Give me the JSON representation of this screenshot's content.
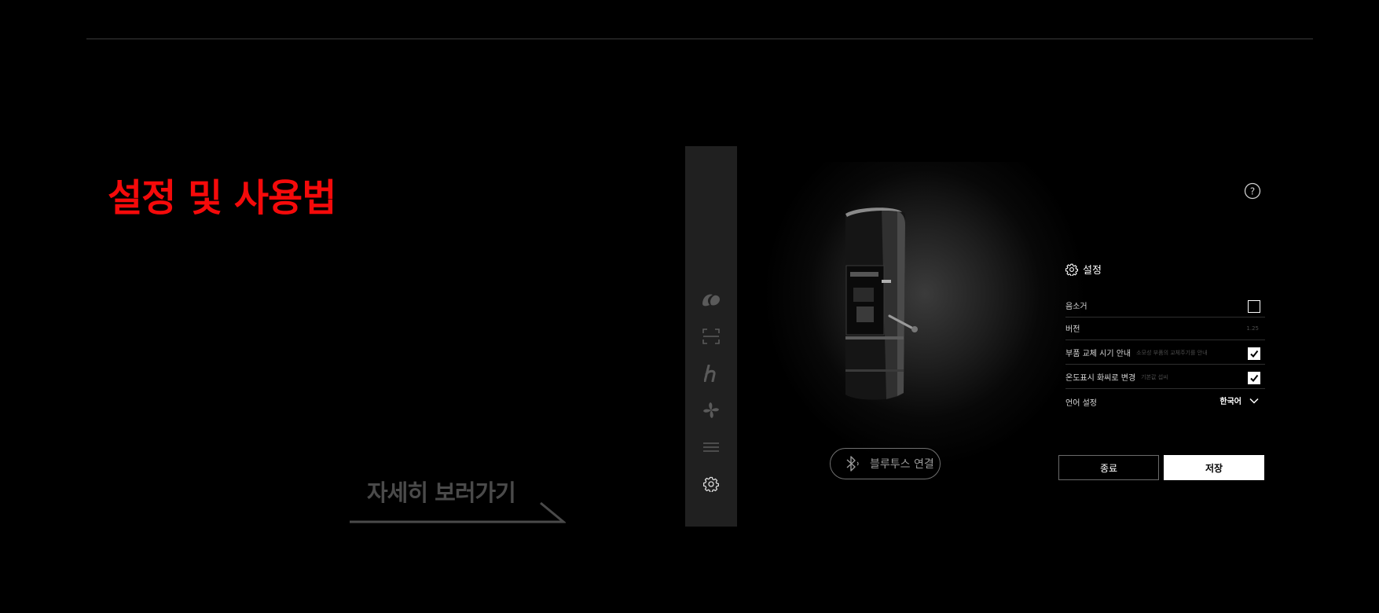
{
  "page": {
    "title": "설정 및 사용법",
    "more_link": "자세히 보러가기"
  },
  "sidebar": {
    "items": [
      {
        "icon": "bean-icon"
      },
      {
        "icon": "scan-icon"
      },
      {
        "icon": "h-logo-icon"
      },
      {
        "icon": "fan-icon"
      },
      {
        "icon": "menu-icon"
      },
      {
        "icon": "gear-icon"
      }
    ]
  },
  "device": {
    "bluetooth_label": "블루투스 연결"
  },
  "settings": {
    "title": "설정",
    "rows": {
      "mute": {
        "label": "음소거",
        "checked": false
      },
      "version": {
        "label": "버전",
        "value": "1.25"
      },
      "parts": {
        "label": "부품 교체 시기 안내",
        "hint": "소모성 부품의 교체주기를 안내",
        "checked": true
      },
      "temp": {
        "label": "온도표시 화씨로 변경",
        "hint": "기본값 섭씨",
        "checked": true
      },
      "language": {
        "label": "언어 설정",
        "value": "한국어"
      }
    },
    "buttons": {
      "end": "종료",
      "save": "저장"
    }
  },
  "colors": {
    "title_red": "#f50a0a",
    "sidebar_bg": "#202020",
    "muted_text": "#4a4a4a"
  }
}
